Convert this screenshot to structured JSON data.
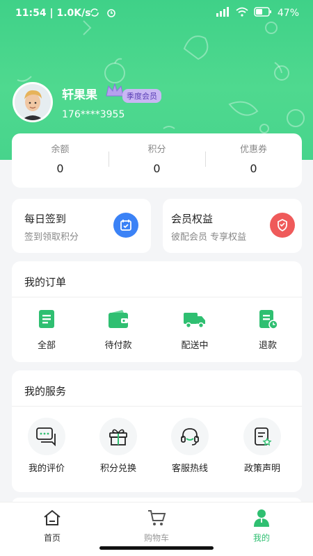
{
  "status_bar": {
    "time": "11:54",
    "speed": "1.0K/s",
    "battery": "47"
  },
  "profile": {
    "name": "轩果果",
    "badge": "季度会员",
    "phone": "176****3955"
  },
  "stats": [
    {
      "label": "余额",
      "value": "0"
    },
    {
      "label": "积分",
      "value": "0"
    },
    {
      "label": "优惠券",
      "value": "0"
    }
  ],
  "quick_cards": {
    "checkin": {
      "title": "每日签到",
      "subtitle": "签到领取积分",
      "icon": "calendar-check-icon"
    },
    "member": {
      "title": "会员权益",
      "subtitle": "彼配会员 专享权益",
      "icon": "member-medal-icon"
    }
  },
  "orders": {
    "title": "我的订单",
    "items": [
      {
        "label": "全部",
        "icon": "clipboard-list-icon"
      },
      {
        "label": "待付款",
        "icon": "wallet-icon"
      },
      {
        "label": "配送中",
        "icon": "truck-icon"
      },
      {
        "label": "退款",
        "icon": "refund-clipboard-icon"
      }
    ]
  },
  "services": {
    "title": "我的服务",
    "items": [
      {
        "label": "我的评价",
        "icon": "chat-bubbles-icon"
      },
      {
        "label": "积分兑换",
        "icon": "gift-icon"
      },
      {
        "label": "客服热线",
        "icon": "headset-icon"
      },
      {
        "label": "政策声明",
        "icon": "document-star-icon"
      }
    ]
  },
  "tabbar": {
    "items": [
      {
        "label": "首页",
        "icon": "home-icon"
      },
      {
        "label": "购物车",
        "icon": "cart-icon"
      },
      {
        "label": "我的",
        "icon": "user-icon"
      }
    ]
  },
  "colors": {
    "brand_green": "#2fbf71",
    "header_green": "#45d48b",
    "checkin_blue": "#3b82f6",
    "member_red": "#ef5a5a",
    "tab_inactive": "#999999"
  }
}
